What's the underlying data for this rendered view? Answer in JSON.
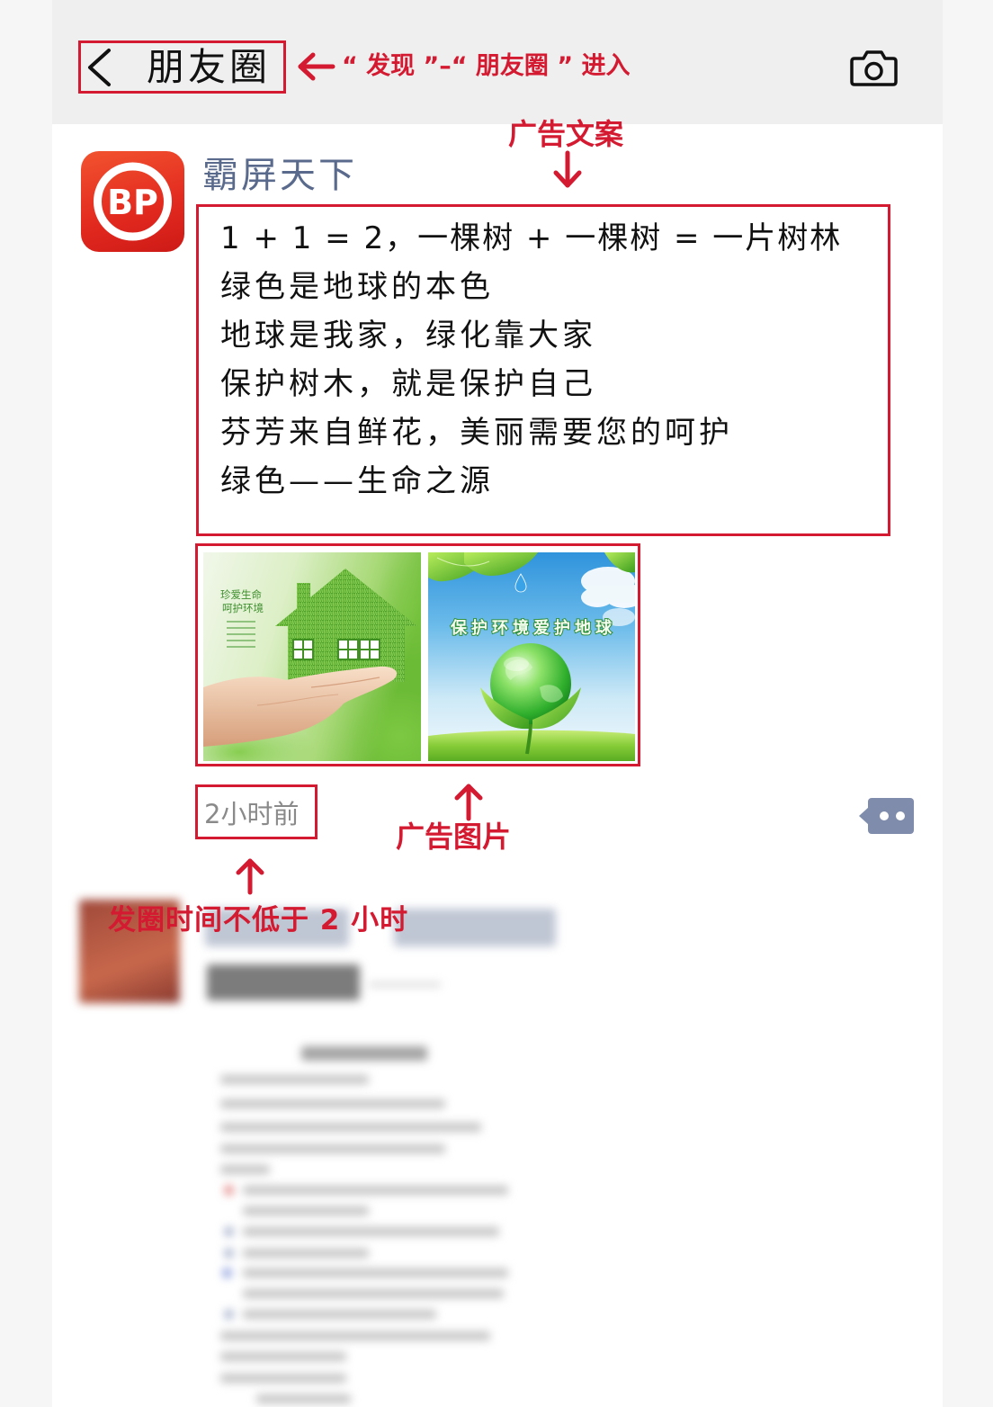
{
  "header": {
    "back_icon": "chevron-left-icon",
    "title": "朋友圈",
    "camera_icon": "camera-icon"
  },
  "annotations": {
    "entry_path": "“ 发现 ”–“ 朋友圈 ” 进入",
    "ad_copy_label": "广告文案",
    "ad_image_label": "广告图片",
    "post_time_rule": "发圈时间不低于 2 小时",
    "arrow_icon": "red-arrow-icon"
  },
  "post": {
    "avatar_logo_text": "BP",
    "author": "霸屏天下",
    "content_lines": [
      "1 + 1 = 2，一棵树 + 一棵树 = 一片树林",
      "绿色是地球的本色",
      "地球是我家，绿化靠大家",
      "保护树木，就是保护自己",
      "芬芳来自鲜花，美丽需要您的呵护",
      "绿色——生命之源"
    ],
    "images": [
      {
        "caption_lines": [
          "珍爱生命",
          "呵护环境"
        ]
      },
      {
        "caption": "保护环境爱护地球"
      }
    ],
    "time": "2小时前",
    "action_icon": "comment-more-icon"
  },
  "colors": {
    "annotation_red": "#d41a31",
    "author_name": "#5a6a8c",
    "timestamp": "#8a8a8a",
    "header_bg": "#efefef",
    "action_button": "#7f8cab"
  }
}
